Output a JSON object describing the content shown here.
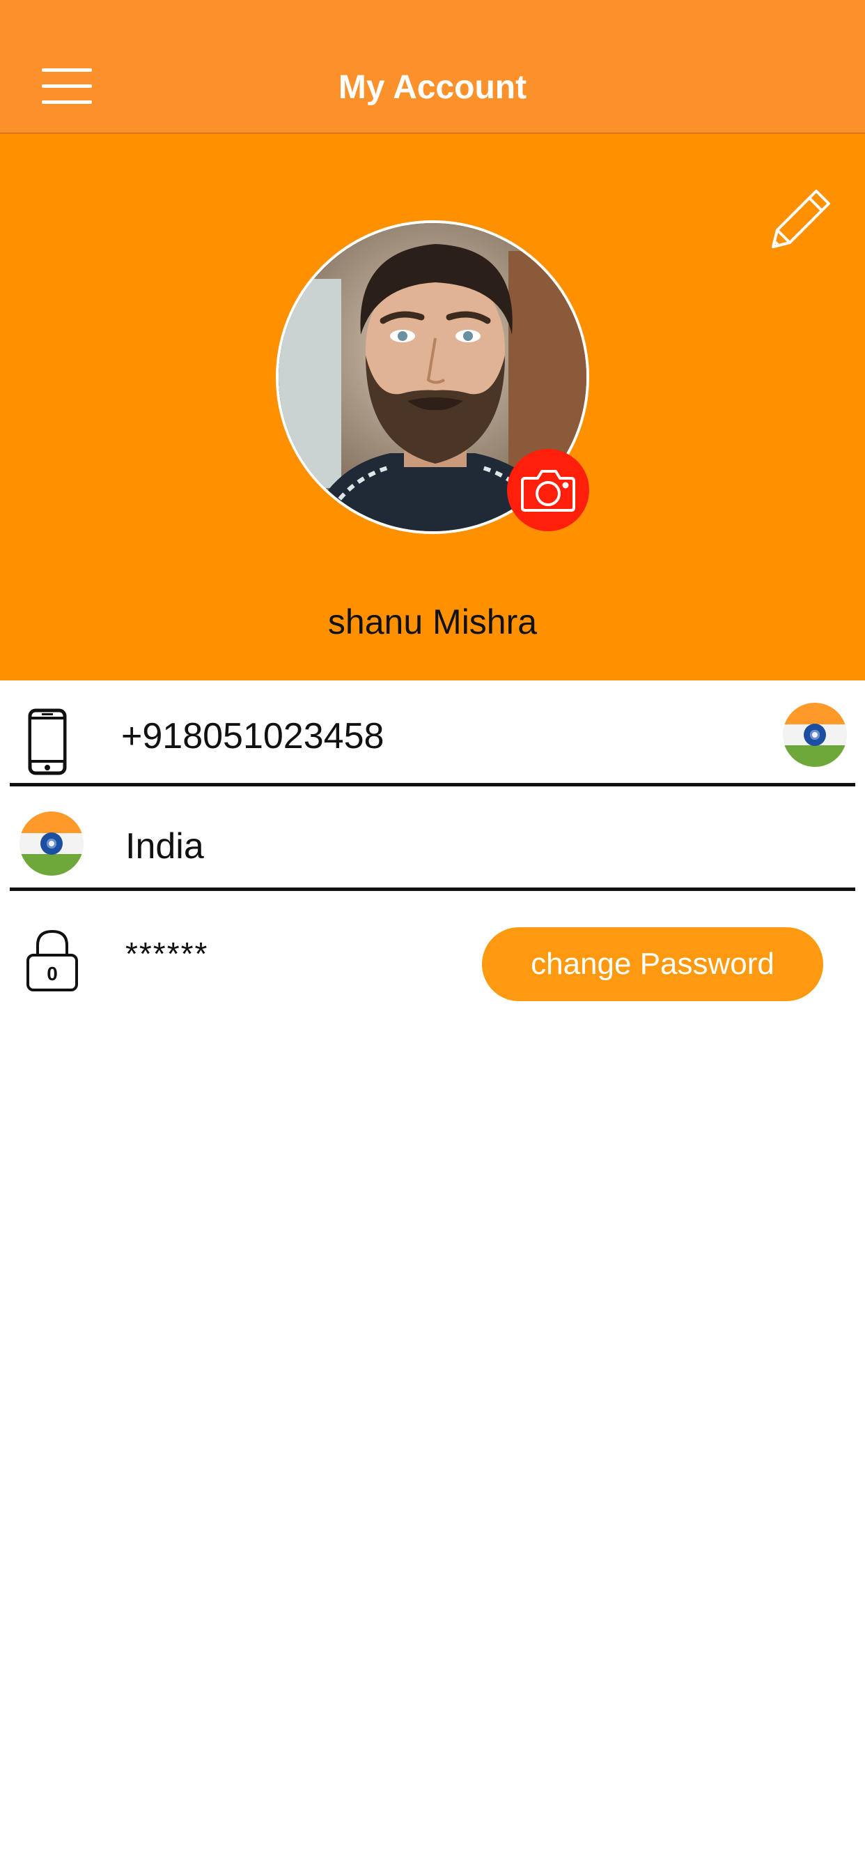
{
  "header": {
    "title": "My Account",
    "menu_icon": "hamburger-menu-icon"
  },
  "profile": {
    "name": "shanu Mishra",
    "edit_icon": "pencil-icon",
    "camera_icon": "camera-icon",
    "avatar": "profile-photo"
  },
  "fields": {
    "phone": {
      "icon": "mobile-phone-icon",
      "value": "+918051023458",
      "country_flag": "india-flag-icon"
    },
    "country": {
      "icon": "india-flag-icon",
      "value": "India"
    },
    "password": {
      "icon": "lock-icon",
      "lock_digit": "0",
      "value": "******",
      "change_label": "change Password"
    }
  },
  "colors": {
    "navbar": "#fc912b",
    "profile_bg": "#ff9000",
    "camera_button": "#ff1f0a",
    "accent_button": "#ff9a10"
  }
}
